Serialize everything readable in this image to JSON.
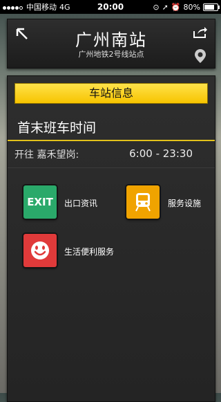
{
  "status_bar": {
    "carrier": "中国移动",
    "network": "4G",
    "time": "20:00",
    "battery": "80%",
    "battery_level": 0.8
  },
  "header": {
    "title": "广州南站",
    "subtitle": "广州地铁2号线站点"
  },
  "panel": {
    "tab_label": "车站信息",
    "section_title": "首末班车时间",
    "route": {
      "label": "开往 嘉禾望岗:",
      "time": "6:00 - 23:30"
    },
    "tiles": [
      {
        "id": "exit",
        "icon_text": "EXIT",
        "label": "出口资讯",
        "color": "#2aa96a"
      },
      {
        "id": "facilities",
        "icon": "train-icon",
        "label": "服务设施",
        "color": "#f0a300"
      },
      {
        "id": "life",
        "icon": "smiley-icon",
        "label": "生活便利服务",
        "color": "#e03a3a"
      }
    ]
  },
  "colors": {
    "accent_yellow": "#f7c400",
    "header_bg": "#1c1c1c"
  }
}
